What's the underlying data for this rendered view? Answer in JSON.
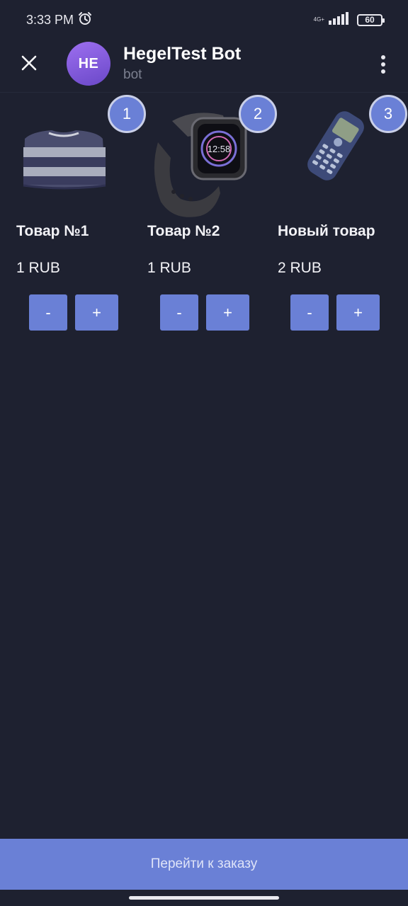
{
  "status_bar": {
    "time": "3:33 PM",
    "network_type": "4G+",
    "battery": "60",
    "alarm_icon": "alarm-clock-icon",
    "signal_icon": "signal-bars-icon"
  },
  "header": {
    "close_icon": "close-icon",
    "avatar_initials": "HE",
    "title": "HegelTest Bot",
    "subtitle": "bot",
    "menu_icon": "more-vertical-icon"
  },
  "products": [
    {
      "badge": "1",
      "name": "Товар №1",
      "price": "1 RUB",
      "minus_label": "-",
      "plus_label": "+",
      "image": "sweater"
    },
    {
      "badge": "2",
      "name": "Товар №2",
      "price": "1 RUB",
      "minus_label": "-",
      "plus_label": "+",
      "image": "smartwatch",
      "watch_time": "12:58"
    },
    {
      "badge": "3",
      "name": "Новый товар",
      "price": "2 RUB",
      "minus_label": "-",
      "plus_label": "+",
      "image": "mobile-phone"
    }
  ],
  "footer": {
    "order_button_label": "Перейти к заказу"
  },
  "colors": {
    "background": "#1e2130",
    "accent": "#6a80d6",
    "avatar_gradient_start": "#9d6ff0",
    "avatar_gradient_end": "#6a48c8"
  }
}
